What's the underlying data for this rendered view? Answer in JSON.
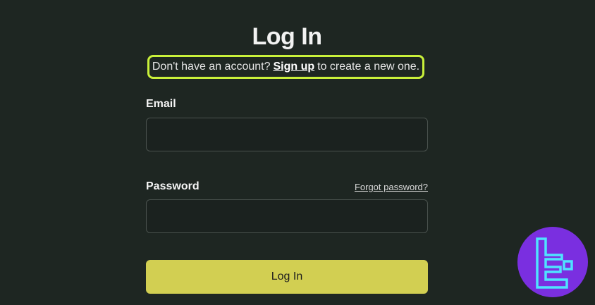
{
  "page": {
    "title": "Log In"
  },
  "signup_hint": {
    "prefix": "Don't have an account?",
    "link": "Sign up",
    "suffix": "to create a new one."
  },
  "form": {
    "email_label": "Email",
    "email_value": "",
    "password_label": "Password",
    "password_value": "",
    "forgot_link": "Forgot password?",
    "submit_label": "Log In"
  },
  "colors": {
    "background": "#1e2622",
    "highlight_border": "#c9f03a",
    "button": "#d2cf52",
    "logo_background": "#7a2fe0",
    "logo_mark": "#4fe3ff"
  },
  "icons": {
    "brand_logo": "brand-logo-icon"
  }
}
